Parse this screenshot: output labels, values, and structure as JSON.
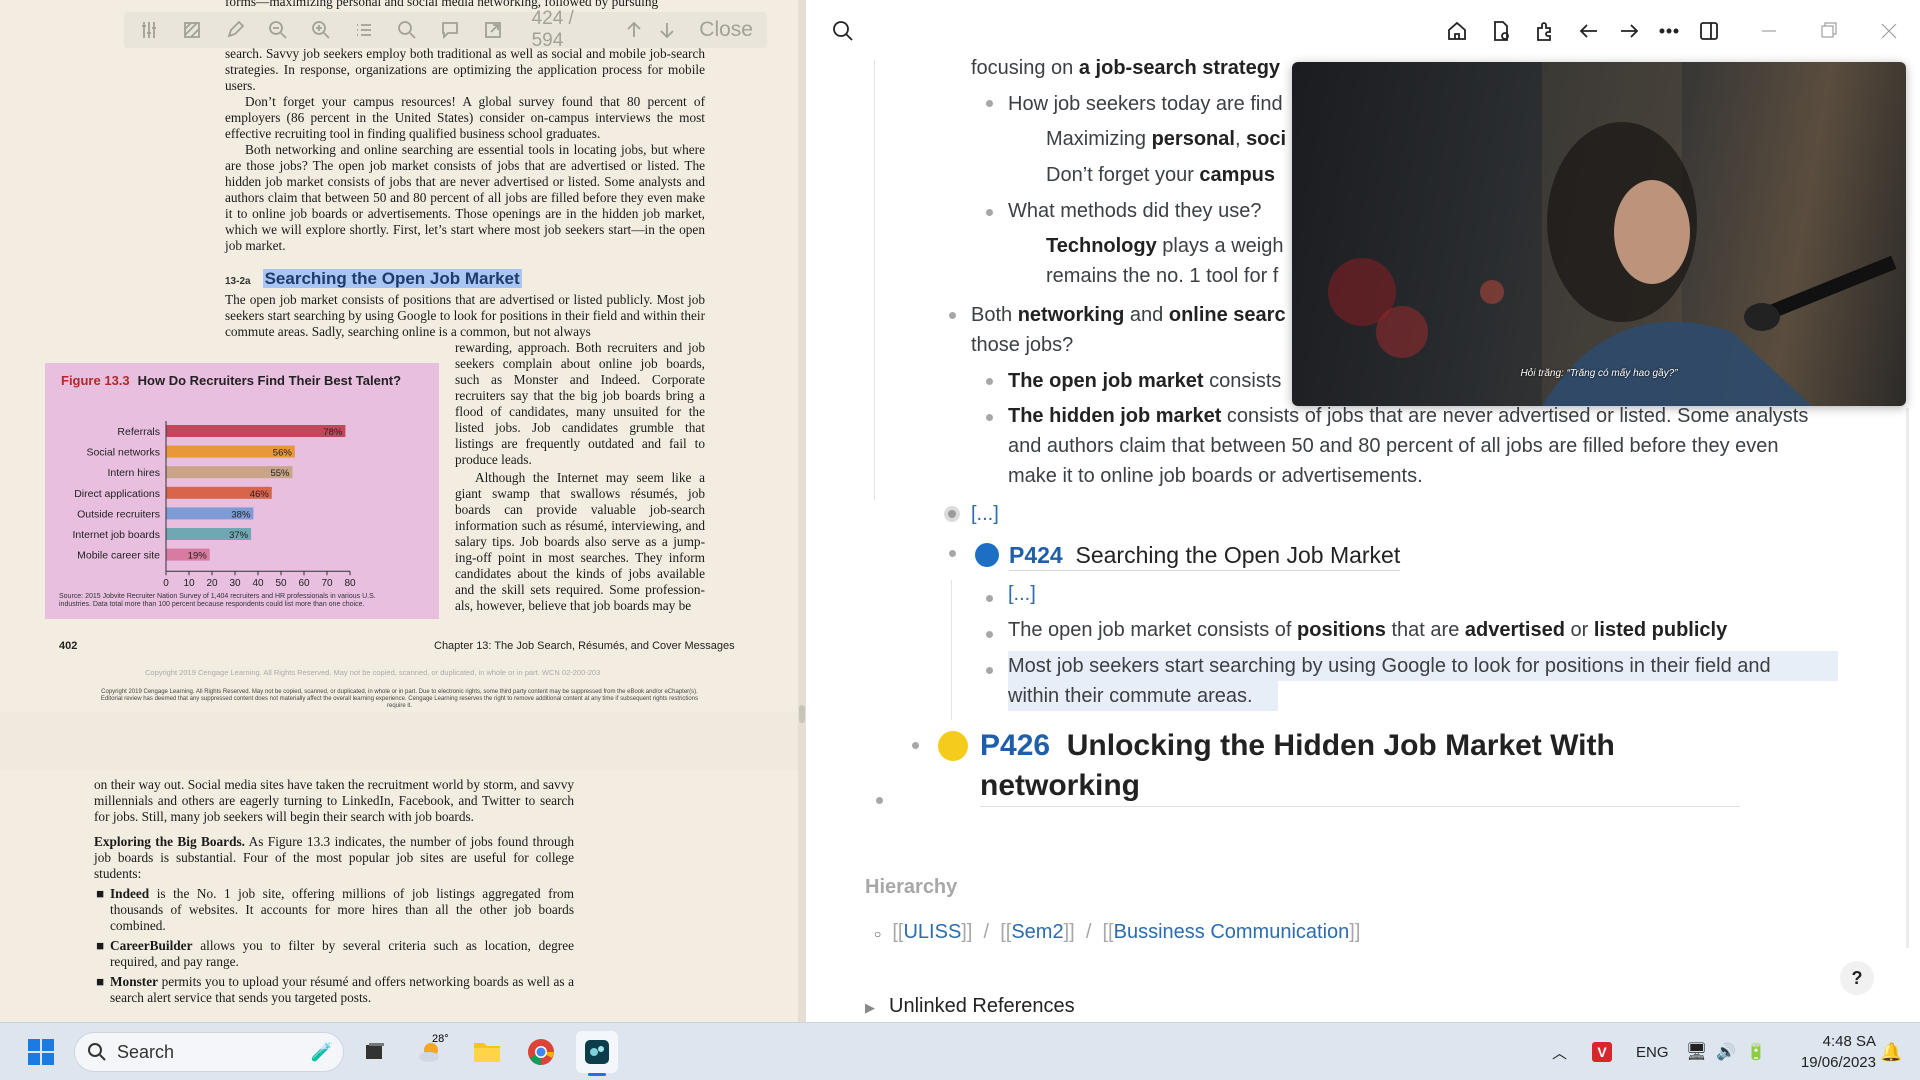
{
  "pdf": {
    "toolbar": {
      "page_indicator": "424 / 594",
      "close_label": "Close"
    },
    "top_cut": "forms—maximizing personal and social media networking, followed by pursuing",
    "para1": "search. Savvy job seekers employ both traditional as well as social and mobile job-search strategies. In response, organizations are optimizing the application process for mobile users.",
    "para2": "Don’t forget your campus resources! A global survey found that 80 percent of employers (86 percent in the United States) consider on-campus interviews the most effective recruiting tool in finding qualified business school graduates.",
    "para3": "Both networking and online searching are essential tools in locating jobs, but where are those jobs? The open job market consists of jobs that are advertised or listed. The hidden job market consists of jobs that are never advertised or listed. Some analysts and authors claim that between 50 and 80 percent of all jobs are filled before they even make it to online job boards or advertisements. Those openings are in the hidden job market, which we will explore shortly. First, let’s start where most job seekers start—in the open job market.",
    "section_num": "13-2a",
    "section_title": "Searching the Open Job Market",
    "para4": "The open job market consists of positions that are advertised or listed publicly. Most job seekers start searching by using Google to look for positions in their field and within their commute areas. Sadly, searching online is a common, but not always",
    "para5_col": "rewarding, approach. Both recruiters and job seekers complain about online job boards, such as Monster and Indeed. Corporate recruiters say that the big job boards bring a flood of candidates, many unsuited for the listed jobs. Job candidates grumble that listings are frequently outdated and fail to produce leads.",
    "para6_col": "Although the Internet may seem like a giant swamp that swallows résumés, job boards can provide valuable job-search information such as résumé, interviewing, and salary tips. Job boards also serve as a jump-ing-off point in most searches. They inform candidates about the kinds of jobs available and the skill sets required. Some profession-als, however, believe that job boards may be",
    "figure_num": "Figure 13.3",
    "figure_title": "How Do Recruiters Find Their Best Talent?",
    "figure_source": "Source: 2015 Jobvite Recruiter Nation Survey of 1,404 recruiters and HR professionals in various U.S. industries. Data total more than 100 percent because respondents could list more than one choice.",
    "page_number": "402",
    "chapter_footer": "Chapter 13: The Job Search, Résumés, and Cover Messages",
    "copyright1": "Copyright 2019 Cengage Learning. All Rights Reserved. May not be copied, scanned, or duplicated, in whole or in part. WCN 02-200-203",
    "copyright2": "Copyright 2019 Cengage Learning. All Rights Reserved. May not be copied, scanned, or duplicated, in whole or in part. Due to electronic rights, some third party content may be suppressed from the eBook and/or eChapter(s). Editorial review has deemed that any suppressed content does not materially affect the overall learning experience. Cengage Learning reserves the right to remove additional content at any time if subsequent rights restrictions require it.",
    "p2_para1": "on their way out. Social media sites have taken the recruitment world by storm, and savvy millennials and others are eagerly turning to LinkedIn, Facebook, and Twitter to search for jobs. Still, many job seekers will begin their search with job boards.",
    "p2_head": "Exploring the Big Boards.",
    "p2_para2": "As Figure 13.3 indicates, the number of jobs found through job boards is substantial. Four of the most popular job sites are useful for college students:",
    "p2_bullets": [
      {
        "bold": "Indeed",
        "text": "is the No. 1 job site, offering millions of job listings aggregated from thousands of websites. It accounts for more hires than all the other job boards combined."
      },
      {
        "bold": "CareerBuilder",
        "text": "allows you to filter by several criteria such as location, degree required, and pay range."
      },
      {
        "bold": "Monster",
        "text": "permits you to upload your résumé and offers networking boards as well as a search alert service that sends you targeted posts."
      }
    ]
  },
  "chart_data": {
    "type": "bar",
    "orientation": "horizontal",
    "title": "How Do Recruiters Find Their Best Talent?",
    "categories": [
      "Referrals",
      "Social networks",
      "Intern hires",
      "Direct applications",
      "Outside recruiters",
      "Internet job boards",
      "Mobile career site"
    ],
    "values": [
      78,
      56,
      55,
      46,
      38,
      37,
      19
    ],
    "value_labels": [
      "78%",
      "56%",
      "55%",
      "46%",
      "38%",
      "37%",
      "19%"
    ],
    "colors": [
      "#c0485a",
      "#e8973a",
      "#c9a488",
      "#d8654a",
      "#7f9bd4",
      "#6fa7b3",
      "#d97aa0"
    ],
    "xlim": [
      0,
      80
    ],
    "xticks": [
      "0",
      "10",
      "20",
      "30",
      "40",
      "50",
      "60",
      "70",
      "80"
    ]
  },
  "notes": {
    "b1": {
      "pre": "focusing on ",
      "bold": "a job-search strategy"
    },
    "b2": "How job seekers today are find",
    "b3": {
      "pre": "Maximizing ",
      "bold1": "personal",
      "mid": ", ",
      "bold2": "soci"
    },
    "b4": {
      "pre": "Don’t forget your ",
      "bold": "campus"
    },
    "b5": "What methods did they use?",
    "b6": {
      "bold": "Technology",
      "post": " plays a weigh"
    },
    "b6b": "remains the no. 1 tool for f",
    "b7": {
      "pre": "Both ",
      "bold1": "networking",
      "mid": " and ",
      "bold2": "online searc"
    },
    "b7b": "those jobs?",
    "b8": {
      "bold": "The open job market",
      "post": " consists"
    },
    "b9": {
      "bold": "The hidden job market",
      "post": " consists of jobs that are never advertised or listed. Some analysts"
    },
    "b9b": "and authors claim that between 50 and 80 percent of all jobs are filled before they even",
    "b9c": "make it to online job boards or advertisements.",
    "ellipsis1": "[...]",
    "p424_tag": "P424",
    "p424_title": "Searching the Open Job Market",
    "ellipsis2": "[...]",
    "b10": {
      "pre": "The open job market consists of ",
      "bold1": "positions",
      "mid1": " that are ",
      "bold2": "advertised",
      "mid2": " or ",
      "bold3": "listed publicly"
    },
    "b11": "Most job seekers start searching by using Google to look for positions in their field and",
    "b11b": "within their commute areas.",
    "p426_tag": "P426",
    "p426_title": "Unlocking the Hidden Job Market With networking",
    "hierarchy_label": "Hierarchy",
    "hierarchy": [
      "ULISS",
      "Sem2",
      "Bussiness Communication"
    ],
    "hierarchy_sep": "/",
    "unlinked": "Unlinked References",
    "help": "?"
  },
  "video": {
    "subtitle": "Hỏi trăng: “Trăng có mấy hao gầy?”"
  },
  "taskbar": {
    "search_label": "Search",
    "weather": "28°",
    "language": "ENG",
    "time": "4:48 SA",
    "date": "19/06/2023"
  }
}
